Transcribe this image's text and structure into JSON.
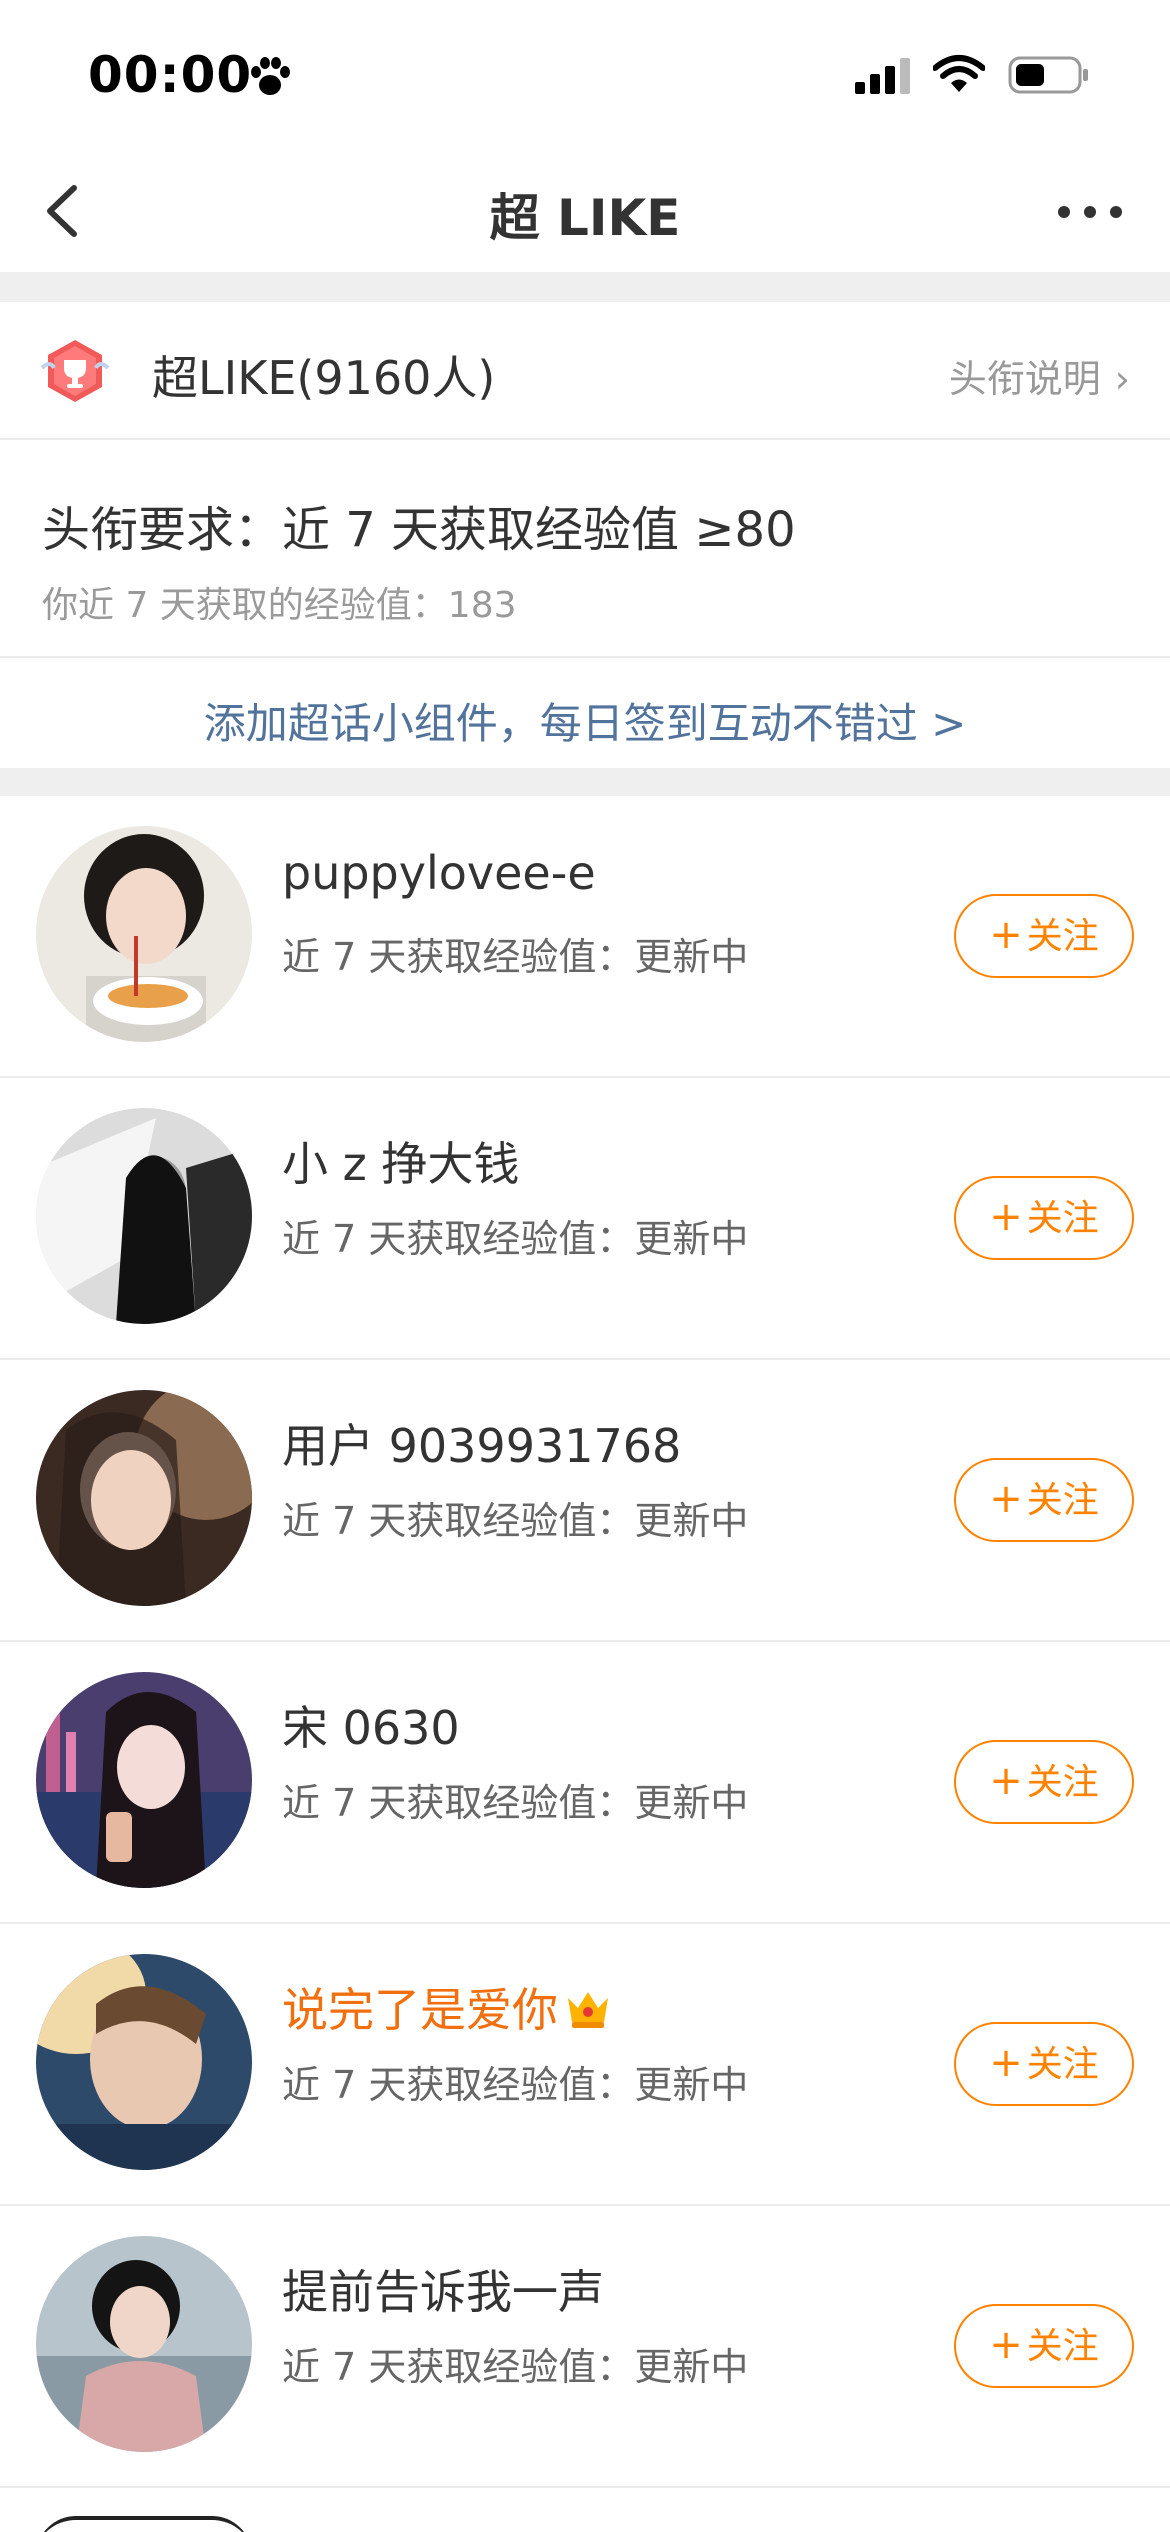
{
  "status_bar": {
    "time": "00:00",
    "icons": [
      "paw-icon",
      "signal-icon",
      "wifi-icon",
      "battery-icon"
    ]
  },
  "nav": {
    "title": "超 LIKE",
    "back_icon": "chevron-left-icon",
    "more_icon": "more-dots-icon"
  },
  "header": {
    "title": "超LIKE(9160人)",
    "link_label": "头衔说明",
    "link_chevron": "›",
    "badge_icon": "trophy-badge-icon"
  },
  "requirement": {
    "title": "头衔要求：近 7 天获取经验值 ≥80",
    "sub": "你近 7 天获取的经验值：183"
  },
  "banner": {
    "text": "添加超话小组件，每日签到互动不错过 >"
  },
  "users": [
    {
      "name": "puppylovee-e",
      "sub": "近 7 天获取经验值：更新中",
      "button": "关注",
      "plus": "+",
      "highlight": false
    },
    {
      "name": "小 z 挣大钱",
      "sub": "近 7 天获取经验值：更新中",
      "button": "关注",
      "plus": "+",
      "highlight": false
    },
    {
      "name": "用户 9039931768",
      "sub": "近 7 天获取经验值：更新中",
      "button": "关注",
      "plus": "+",
      "highlight": false
    },
    {
      "name": "宋 0630",
      "sub": "近 7 天获取经验值：更新中",
      "button": "关注",
      "plus": "+",
      "highlight": false
    },
    {
      "name": "说完了是爱你",
      "sub": "近 7 天获取经验值：更新中",
      "button": "关注",
      "plus": "+",
      "highlight": true
    },
    {
      "name": "提前告诉我一声",
      "sub": "近 7 天获取经验值：更新中",
      "button": "关注",
      "plus": "+",
      "highlight": false
    }
  ],
  "colors": {
    "accent": "#ff8200",
    "vip_name": "#f26f0f",
    "link": "#51739c",
    "divider": "#efefef"
  }
}
